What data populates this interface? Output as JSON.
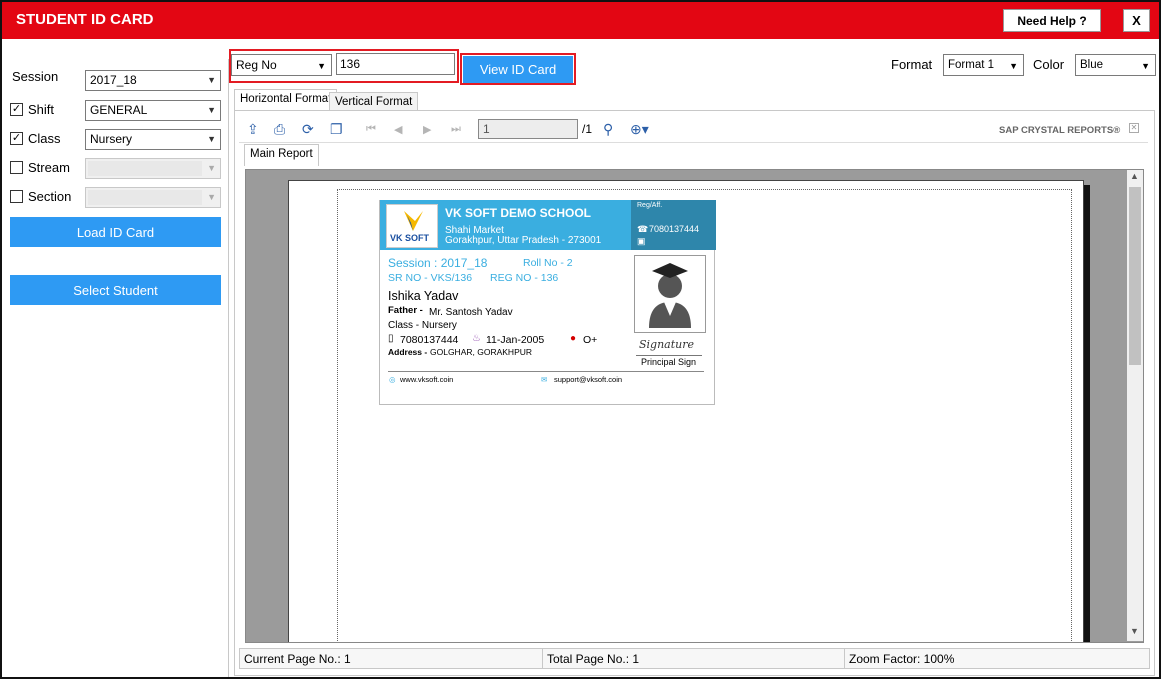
{
  "window": {
    "title": "STUDENT ID CARD",
    "help_label": "Need Help ?",
    "close_label": "X"
  },
  "filters": {
    "session": {
      "label": "Session",
      "value": "2017_18"
    },
    "shift": {
      "label": "Shift",
      "value": "GENERAL",
      "checked": "✓"
    },
    "class": {
      "label": "Class",
      "value": "Nursery",
      "checked": "✓"
    },
    "stream": {
      "label": "Stream",
      "value": ""
    },
    "section": {
      "label": "Section",
      "value": ""
    },
    "load_button": "Load ID Card",
    "select_button": "Select Student"
  },
  "search": {
    "type": "Reg No",
    "value": "136",
    "view_button": "View ID Card"
  },
  "format": {
    "label": "Format",
    "value": "Format 1"
  },
  "color": {
    "label": "Color",
    "value": "Blue"
  },
  "tabs": [
    "Horizontal Format",
    "Vertical Format"
  ],
  "viewer": {
    "page_value": "1",
    "page_total": "/1",
    "brand": "SAP CRYSTAL REPORTS®",
    "report_tab": "Main Report",
    "status": {
      "current": "Current Page No.: 1",
      "total": "Total Page No.: 1",
      "zoom": "Zoom Factor: 100%"
    }
  },
  "idcard": {
    "school": "VK SOFT DEMO SCHOOL",
    "addr1": "Shahi Market",
    "addr2": "Gorakhpur, Uttar Pradesh - 273001",
    "reg_aff": "Reg/Aff.",
    "phone_top": "7080137444",
    "logo": "VK SOFT",
    "session": "Session : 2017_18",
    "roll": "Roll No - 2",
    "sr": "SR NO - VKS/136",
    "reg": "REG NO -  136",
    "name": "Ishika Yadav",
    "father_label": "Father -",
    "father": "Mr. Santosh Yadav",
    "class": "Class -  Nursery",
    "phone": "7080137444",
    "dob": "11-Jan-2005",
    "blood": "O+",
    "address_label": "Address -",
    "address": "GOLGHAR, GORAKHPUR",
    "signature": "Signature",
    "principal": "Principal Sign",
    "website": "www.vksoft.coin",
    "email": "support@vksoft.coin"
  }
}
